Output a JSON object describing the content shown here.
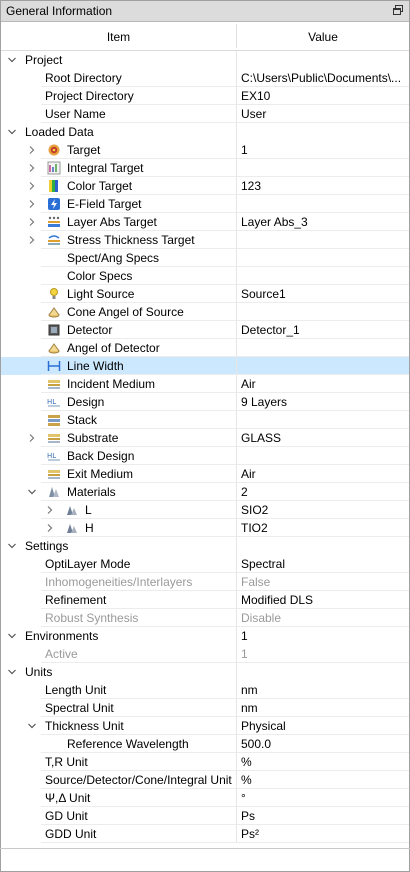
{
  "panel": {
    "title": "General Information",
    "restore_icon": "restore-window-icon",
    "columns": {
      "item": "Item",
      "value": "Value"
    }
  },
  "rows": [
    {
      "label": "Project",
      "value": "",
      "indent": 0,
      "expander": "open",
      "category": true
    },
    {
      "label": "Root Directory",
      "value": "C:\\Users\\Public\\Documents\\...",
      "indent": 2
    },
    {
      "label": "Project Directory",
      "value": "EX10",
      "indent": 2
    },
    {
      "label": "User Name",
      "value": "User",
      "indent": 2
    },
    {
      "label": "Loaded Data",
      "value": "",
      "indent": 0,
      "expander": "open",
      "category": true
    },
    {
      "label": "Target",
      "value": "1",
      "indent": 2,
      "expander": "closed",
      "icon": "target-icon"
    },
    {
      "label": "Integral Target",
      "value": "",
      "indent": 2,
      "expander": "closed",
      "icon": "integral-target-icon"
    },
    {
      "label": "Color Target",
      "value": "123",
      "indent": 2,
      "expander": "closed",
      "icon": "color-target-icon"
    },
    {
      "label": "E-Field Target",
      "value": "",
      "indent": 2,
      "expander": "closed",
      "icon": "efield-target-icon"
    },
    {
      "label": "Layer Abs Target",
      "value": "Layer Abs_3",
      "indent": 2,
      "expander": "closed",
      "icon": "layer-abs-icon"
    },
    {
      "label": "Stress Thickness Target",
      "value": "",
      "indent": 2,
      "expander": "closed",
      "icon": "stress-thickness-icon"
    },
    {
      "label": "Spect/Ang Specs",
      "value": "",
      "indent": 3
    },
    {
      "label": "Color Specs",
      "value": "",
      "indent": 3
    },
    {
      "label": "Light Source",
      "value": "Source1",
      "indent": 2,
      "icon": "light-source-icon"
    },
    {
      "label": "Cone Angel of Source",
      "value": "",
      "indent": 2,
      "icon": "cone-icon"
    },
    {
      "label": "Detector",
      "value": "Detector_1",
      "indent": 2,
      "icon": "detector-icon"
    },
    {
      "label": "Angel of Detector",
      "value": "",
      "indent": 2,
      "icon": "cone-icon"
    },
    {
      "label": "Line Width",
      "value": "",
      "indent": 2,
      "icon": "line-width-icon",
      "selected": true
    },
    {
      "label": "Incident Medium",
      "value": "Air",
      "indent": 2,
      "icon": "medium-icon"
    },
    {
      "label": "Design",
      "value": "9 Layers",
      "indent": 2,
      "icon": "design-icon"
    },
    {
      "label": "Stack",
      "value": "",
      "indent": 2,
      "icon": "stack-icon"
    },
    {
      "label": "Substrate",
      "value": "GLASS",
      "indent": 2,
      "expander": "closed",
      "icon": "medium-icon"
    },
    {
      "label": "Back Design",
      "value": "",
      "indent": 2,
      "icon": "design-icon"
    },
    {
      "label": "Exit Medium",
      "value": "Air",
      "indent": 2,
      "icon": "medium-icon"
    },
    {
      "label": "Materials",
      "value": "2",
      "indent": 2,
      "expander": "open",
      "icon": "materials-icon"
    },
    {
      "label": "L",
      "value": "SIO2",
      "indent": 3,
      "expander": "closed",
      "icon": "material-icon"
    },
    {
      "label": "H",
      "value": "TIO2",
      "indent": 3,
      "expander": "closed",
      "icon": "material-icon"
    },
    {
      "label": "Settings",
      "value": "",
      "indent": 0,
      "expander": "open",
      "category": true
    },
    {
      "label": "OptiLayer Mode",
      "value": "Spectral",
      "indent": 2
    },
    {
      "label": "Inhomogeneities/Interlayers",
      "value": "False",
      "indent": 2,
      "disabled": true
    },
    {
      "label": "Refinement",
      "value": "Modified DLS",
      "indent": 2
    },
    {
      "label": "Robust Synthesis",
      "value": "Disable",
      "indent": 2,
      "disabled": true
    },
    {
      "label": "Environments",
      "value": "1",
      "indent": 0,
      "expander": "open",
      "category": true
    },
    {
      "label": "Active",
      "value": "1",
      "indent": 2,
      "disabled": true
    },
    {
      "label": "Units",
      "value": "",
      "indent": 0,
      "expander": "open",
      "category": true
    },
    {
      "label": "Length Unit",
      "value": "nm",
      "indent": 2
    },
    {
      "label": "Spectral Unit",
      "value": "nm",
      "indent": 2
    },
    {
      "label": "Thickness Unit",
      "value": "Physical",
      "indent": 2,
      "expander": "open"
    },
    {
      "label": "Reference Wavelength",
      "value": "500.0",
      "indent": 3
    },
    {
      "label": "T,R Unit",
      "value": "%",
      "indent": 2
    },
    {
      "label": "Source/Detector/Cone/Integral Unit",
      "value": "%",
      "indent": 2
    },
    {
      "label": "Ψ,Δ Unit",
      "value": "°",
      "indent": 2
    },
    {
      "label": "GD Unit",
      "value": "Ps",
      "indent": 2
    },
    {
      "label": "GDD Unit",
      "value": "Ps²",
      "indent": 2
    }
  ]
}
